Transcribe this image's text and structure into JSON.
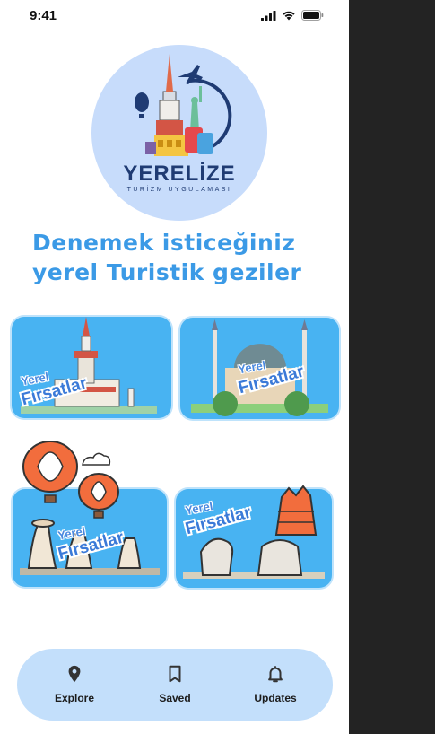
{
  "status_bar": {
    "time": "9:41"
  },
  "logo": {
    "title": "YERELİZE",
    "subtitle": "TURİZM UYGULAMASI"
  },
  "headline": {
    "line1": "Denemek isticeğiniz",
    "line2": "yerel Turistik geziler"
  },
  "cards": [
    {
      "name": "card-maiden-tower",
      "label_top": "Yerel",
      "label_bottom": "Fırsatlar"
    },
    {
      "name": "card-hagia-sophia",
      "label_top": "Yerel",
      "label_bottom": "Fırsatlar"
    },
    {
      "name": "card-cappadocia",
      "label_top": "Yerel",
      "label_bottom": "Fırsatlar"
    },
    {
      "name": "card-nemrut",
      "label_top": "Yerel",
      "label_bottom": "Fırsatlar"
    }
  ],
  "nav": {
    "items": [
      {
        "label": "Explore",
        "icon": "map-pin-icon"
      },
      {
        "label": "Saved",
        "icon": "bookmark-icon"
      },
      {
        "label": "Updates",
        "icon": "bell-icon"
      }
    ]
  },
  "colors": {
    "accent": "#3b9ae6",
    "card_bg": "#48b3f2",
    "nav_bg": "#c3dffb",
    "side_bg": "#232323"
  }
}
